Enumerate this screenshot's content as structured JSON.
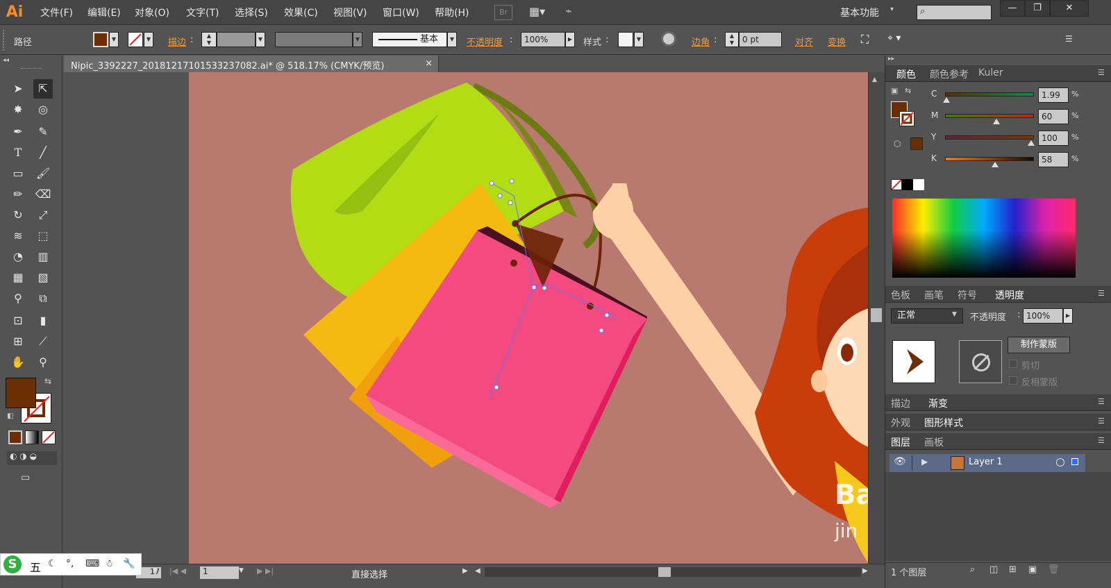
{
  "app": {
    "logo": "Ai"
  },
  "menu": [
    "文件(F)",
    "编辑(E)",
    "对象(O)",
    "文字(T)",
    "选择(S)",
    "效果(C)",
    "视图(V)",
    "窗口(W)",
    "帮助(H)"
  ],
  "menubar": {
    "br_label": "Br",
    "workspace": "基本功能"
  },
  "control": {
    "object_type": "路径",
    "stroke_label": "描边",
    "stroke_profile": "基本",
    "opacity_label": "不透明度",
    "opacity_value": "100%",
    "style_label": "样式",
    "corner_label": "边角",
    "corner_value": "0 pt",
    "align_label": "对齐",
    "transform_label": "变换"
  },
  "document": {
    "tab_title": "Nipic_3392227_20181217101533237082.ai* @ 518.17% (CMYK/预览)",
    "close": "×"
  },
  "status": {
    "page": "1",
    "zoom_partial": "17",
    "tool": "直接选择"
  },
  "color_panel": {
    "tabs": [
      "颜色",
      "颜色参考",
      "Kuler"
    ],
    "channels": [
      {
        "name": "C",
        "value": "1.99",
        "unit": "%",
        "level": 0.02,
        "grad": "#5a2e00,#0f8c4c"
      },
      {
        "name": "M",
        "value": "60",
        "unit": "%",
        "level": 0.6,
        "grad": "#3b7a00,#c0280c"
      },
      {
        "name": "Y",
        "value": "100",
        "unit": "%",
        "level": 1.0,
        "grad": "#6a1e3a,#7a3a00"
      },
      {
        "name": "K",
        "value": "58",
        "unit": "%",
        "level": 0.58,
        "grad": "#f07d10,#1a0a00"
      }
    ],
    "fill_color": "#6b2d04"
  },
  "transparency_panel": {
    "tabs": [
      "色板",
      "画笔",
      "符号",
      "透明度"
    ],
    "blend_mode": "正常",
    "opacity_label": "不透明度",
    "opacity_value": "100%",
    "make_mask": "制作蒙版",
    "clip": "剪切",
    "invert_mask": "反相蒙版"
  },
  "stroke_gradient_tabs": [
    "描边",
    "渐变"
  ],
  "appearance_tabs": [
    "外观",
    "图形样式"
  ],
  "layers_panel": {
    "tabs": [
      "图层",
      "画板"
    ],
    "layers": [
      {
        "name": "Layer 1"
      }
    ],
    "count_label": "1 个图层"
  },
  "watermark": {
    "line1": "Ba",
    "line2": "jin"
  },
  "ime": {
    "label": "五"
  },
  "colors": {
    "accent": "#f39b3d",
    "artboard": "#b87a6e"
  }
}
